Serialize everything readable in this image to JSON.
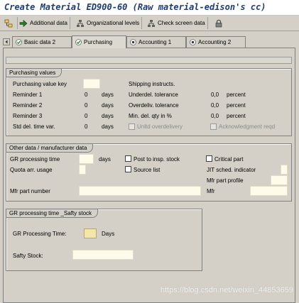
{
  "window": {
    "title": "Create Material ED900-60 (Raw material-edison's cc)"
  },
  "toolbar": {
    "buttons": [
      {
        "label": "",
        "icon": "hierarchy-icon"
      },
      {
        "label": "Additional data",
        "icon": "arrow-right-icon"
      },
      {
        "label": "Organizational levels",
        "icon": "org-levels-icon"
      },
      {
        "label": "Check screen data",
        "icon": "org-levels-icon"
      },
      {
        "label": "",
        "icon": "lock-icon"
      }
    ]
  },
  "tabs": [
    {
      "label": "Basic data 2",
      "icon": "check-icon"
    },
    {
      "label": "Purchasing",
      "icon": "check-icon",
      "active": true
    },
    {
      "label": "Accounting 1",
      "icon": "record-icon"
    },
    {
      "label": "Accounting 2",
      "icon": "record-icon"
    }
  ],
  "purchasing_values": {
    "title": "Purchasing values",
    "value_key_label": "Purchasing value key",
    "value_key": "",
    "reminder1_label": "Reminder 1",
    "reminder1": "0",
    "reminder2_label": "Reminder 2",
    "reminder2": "0",
    "reminder3_label": "Reminder 3",
    "reminder3": "0",
    "std_var_label": "Std del. time var.",
    "std_var": "0",
    "days_unit": "days",
    "shipping_label": "Shipping instructs.",
    "underdel_label": "Underdel. tolerance",
    "underdel": "0,0",
    "overdel_label": "Overdeliv. tolerance",
    "overdel": "0,0",
    "min_del_label": "Min. del. qty in %",
    "min_del": "0,0",
    "percent_unit": "percent",
    "unltd_label": "Unltd overdelivery",
    "ack_label": "Acknowledgment reqd"
  },
  "other_data": {
    "title": "Other data / manufacturer data",
    "gr_time_label": "GR processing time",
    "gr_time_unit": "days",
    "quota_label": "Quota arr. usage",
    "post_insp_label": "Post to insp. stock",
    "source_list_label": "Source list",
    "critical_label": "Critical part",
    "jit_label": "JIT sched. indicator",
    "mfr_profile_label": "Mfr part profile",
    "mfr_part_label": "Mfr part number",
    "mfr_label": "Mfr"
  },
  "gr_safety": {
    "title": "GR processing time _Safty stock",
    "gr_time_label": "GR Processing Time:",
    "gr_time_unit": "Days",
    "safety_label": "Safty  Stock:"
  },
  "watermark": "https://blog.csdn.net/weixin_44853659",
  "colors": {
    "background": "#d4d0c8",
    "title": "#1c3c78",
    "input_field": "#fffbea",
    "cursor_field": "#f2e6a8"
  }
}
